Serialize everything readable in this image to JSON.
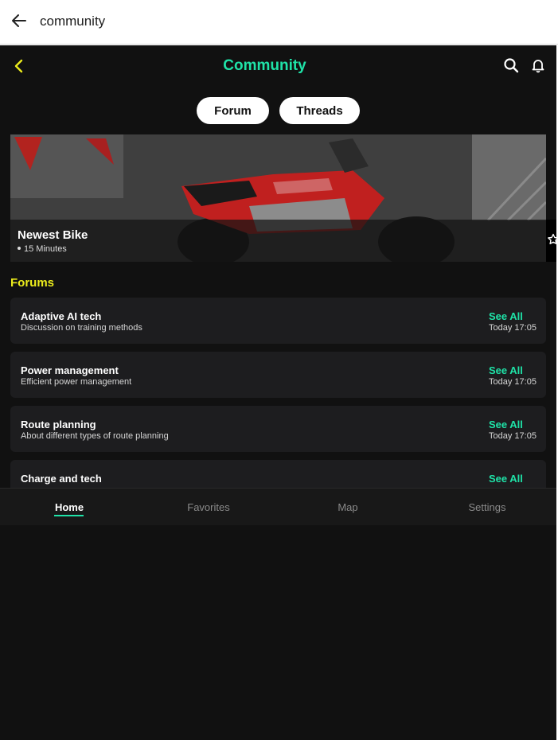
{
  "window": {
    "title": "community"
  },
  "header": {
    "title": "Community"
  },
  "segments": {
    "forum_label": "Forum",
    "threads_label": "Threads"
  },
  "featured": {
    "title": "Newest Bike",
    "meta": "15 Minutes"
  },
  "forums": {
    "heading": "Forums",
    "items": [
      {
        "title": "Adaptive AI tech",
        "subtitle": "Discussion on training methods",
        "action": "See All",
        "time": "Today 17:05"
      },
      {
        "title": "Power management",
        "subtitle": "Efficient power management",
        "action": "See All",
        "time": "Today 17:05"
      },
      {
        "title": "Route planning",
        "subtitle": "About different types of route planning",
        "action": "See All",
        "time": "Today 17:05"
      },
      {
        "title": "Charge and tech",
        "subtitle": "",
        "action": "See All",
        "time": ""
      }
    ]
  },
  "nav": {
    "home": "Home",
    "favorites": "Favorites",
    "map": "Map",
    "settings": "Settings",
    "active": "Home"
  },
  "colors": {
    "accent": "#1fe3a8",
    "section": "#ecec1c",
    "back_arrow": "#ecec1c",
    "background": "#111111",
    "card": "#1d1d1f"
  },
  "icons": [
    "back-arrow-icon",
    "chevron-left-icon",
    "search-icon",
    "bell-icon",
    "star-icon"
  ]
}
